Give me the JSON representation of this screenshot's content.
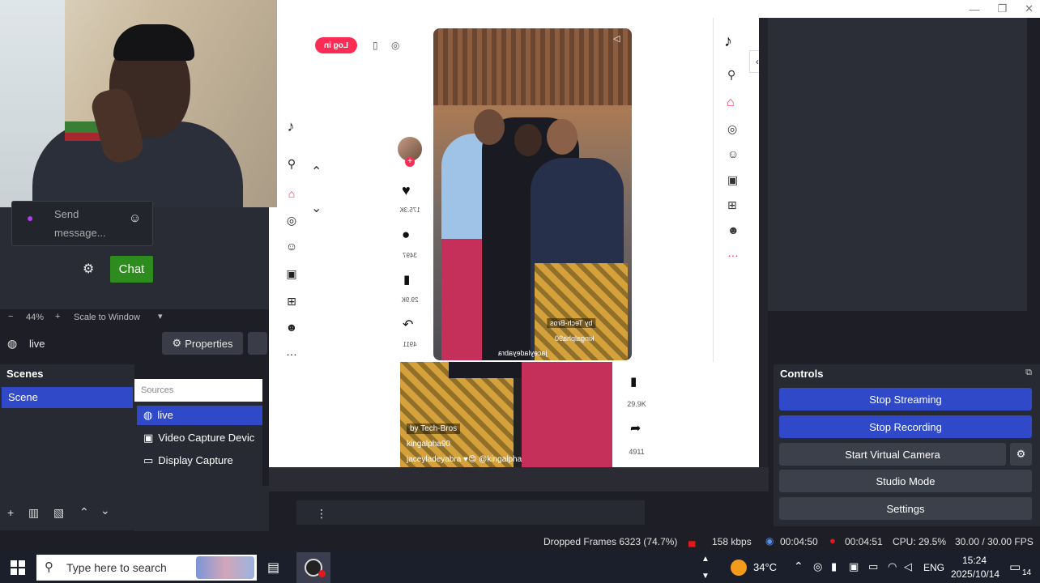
{
  "obs": {
    "chat": {
      "placeholder": "Send message...",
      "button": "Chat"
    },
    "zoom": {
      "level": "44%",
      "scale_mode": "Scale to Window"
    },
    "source_bar": {
      "current_source": "live",
      "properties_label": "Properties"
    },
    "scenes": {
      "title": "Scenes",
      "items": [
        {
          "label": "Scene"
        }
      ]
    },
    "sources": {
      "title": "Sources",
      "items": [
        {
          "label": "live"
        },
        {
          "label": "Video Capture Devic"
        },
        {
          "label": "Display Capture"
        }
      ]
    },
    "controls": {
      "title": "Controls",
      "buttons": {
        "stop_streaming": "Stop Streaming",
        "stop_recording": "Stop Recording",
        "start_virtual_camera": "Start Virtual Camera",
        "studio_mode": "Studio Mode",
        "settings": "Settings"
      }
    },
    "status": {
      "dropped_frames": "Dropped Frames 6323 (74.7%)",
      "bitrate": "158 kbps",
      "stream_time": "00:04:50",
      "rec_time": "00:04:51",
      "cpu": "CPU: 29.5%",
      "fps": "30.00 / 30.00 FPS"
    }
  },
  "tiktok": {
    "login_button": "Log in",
    "post1": {
      "likes": "175.3K",
      "comments": "3497",
      "saves": "29.9K",
      "shares": "4911",
      "caption_user": "kingalpha90",
      "caption_tags": "jaceyladeyabra",
      "credit": "by Tech-Bros"
    },
    "post2": {
      "saves": "29.9K",
      "shares": "4911",
      "caption_user": "kingalpha90",
      "caption_tags": "jaceyladeyabra",
      "credit": "by Tech-Bros",
      "hashtag": "kingalpha"
    }
  },
  "taskbar": {
    "search_placeholder": "Type here to search",
    "temperature": "34°C",
    "language": "ENG",
    "time": "15:24",
    "date": "2025/10/14",
    "notification_count": "14"
  },
  "colors": {
    "accent_blue": "#2f49c9",
    "chat_green": "#2e8b1e",
    "tiktok_red": "#fe2c55",
    "rec_red": "#e0191c"
  }
}
